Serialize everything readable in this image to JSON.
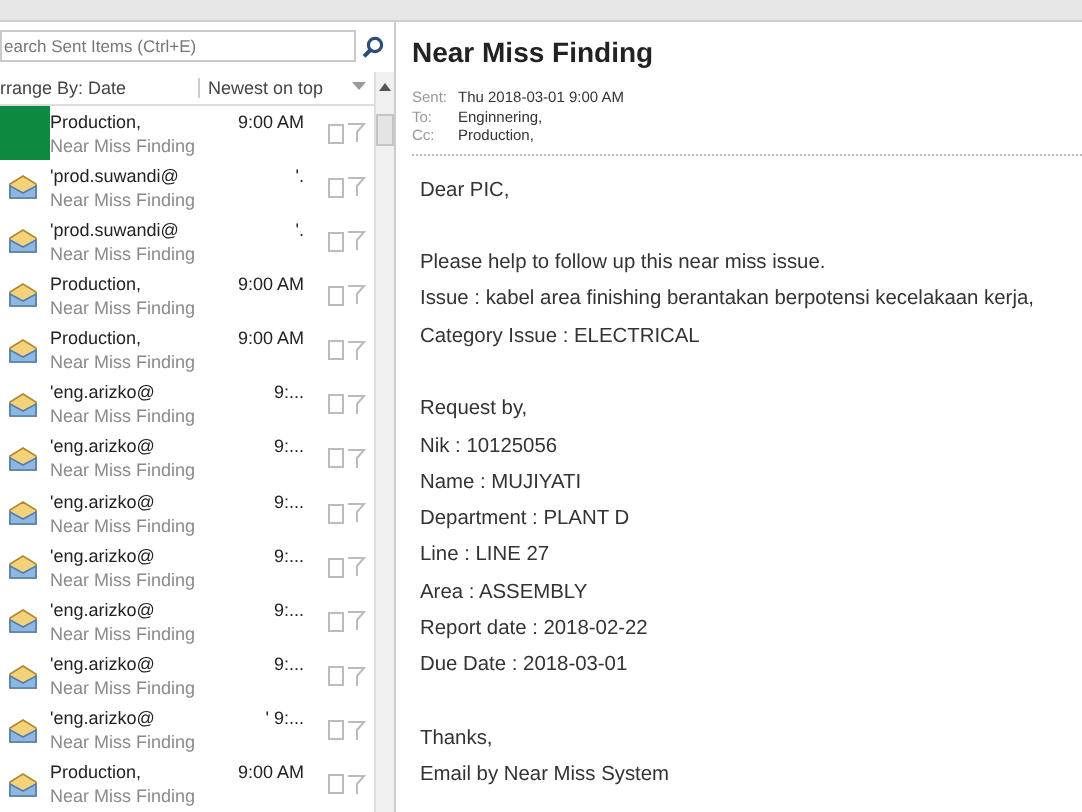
{
  "search": {
    "placeholder": "earch Sent Items (Ctrl+E)"
  },
  "arrange": {
    "label": "rrange By: Date",
    "order": "Newest on top"
  },
  "messages": [
    {
      "sender": "Production,",
      "time": "9:00 AM",
      "subject": "Near Miss Finding",
      "covered": true
    },
    {
      "sender": "'prod.suwandi@",
      "time": "'.",
      "subject": "Near Miss Finding",
      "covered": false
    },
    {
      "sender": "'prod.suwandi@",
      "time": "'.",
      "subject": "Near Miss Finding",
      "covered": false
    },
    {
      "sender": "Production,",
      "time": "9:00 AM",
      "subject": "Near Miss Finding",
      "covered": false
    },
    {
      "sender": "Production,",
      "time": "9:00 AM",
      "subject": "Near Miss Finding",
      "covered": false
    },
    {
      "sender": "'eng.arizko@",
      "time": "9:...",
      "subject": "Near Miss Finding",
      "covered": false
    },
    {
      "sender": "'eng.arizko@",
      "time": "9:...",
      "subject": "Near Miss Finding",
      "covered": false
    },
    {
      "sender": "'eng.arizko@",
      "time": "9:...",
      "subject": "Near Miss Finding",
      "covered": false
    },
    {
      "sender": "'eng.arizko@",
      "time": "9:...",
      "subject": "Near Miss Finding",
      "covered": false
    },
    {
      "sender": "'eng.arizko@",
      "time": "9:...",
      "subject": "Near Miss Finding",
      "covered": false
    },
    {
      "sender": "'eng.arizko@",
      "time": "9:...",
      "subject": "Near Miss Finding",
      "covered": false
    },
    {
      "sender": "'eng.arizko@",
      "time": "' 9:...",
      "subject": "Near Miss Finding",
      "covered": false
    },
    {
      "sender": "Production,",
      "time": "9:00 AM",
      "subject": "Near Miss Finding",
      "covered": false
    }
  ],
  "reading": {
    "title": "Near Miss Finding",
    "headers": [
      {
        "label": "Sent:",
        "value": "Thu 2018-03-01 9:00 AM"
      },
      {
        "label": "To:",
        "value": "Enginnering,"
      },
      {
        "label": "Cc:",
        "value": "Production,"
      }
    ],
    "paragraphs": [
      [
        "Dear PIC,"
      ],
      [
        "Please help to follow up this near miss issue.",
        "Issue : kabel area finishing berantakan berpotensi kecelakaan kerja,",
        "Category Issue : ELECTRICAL"
      ],
      [
        "Request by,",
        "Nik : 10125056",
        "Name : MUJIYATI",
        "Department : PLANT D",
        "Line : LINE 27",
        "Area : ASSEMBLY",
        "Report date : 2018-02-22",
        "Due Date : 2018-03-01"
      ],
      [
        "Thanks,",
        "Email by Near Miss System"
      ]
    ]
  }
}
